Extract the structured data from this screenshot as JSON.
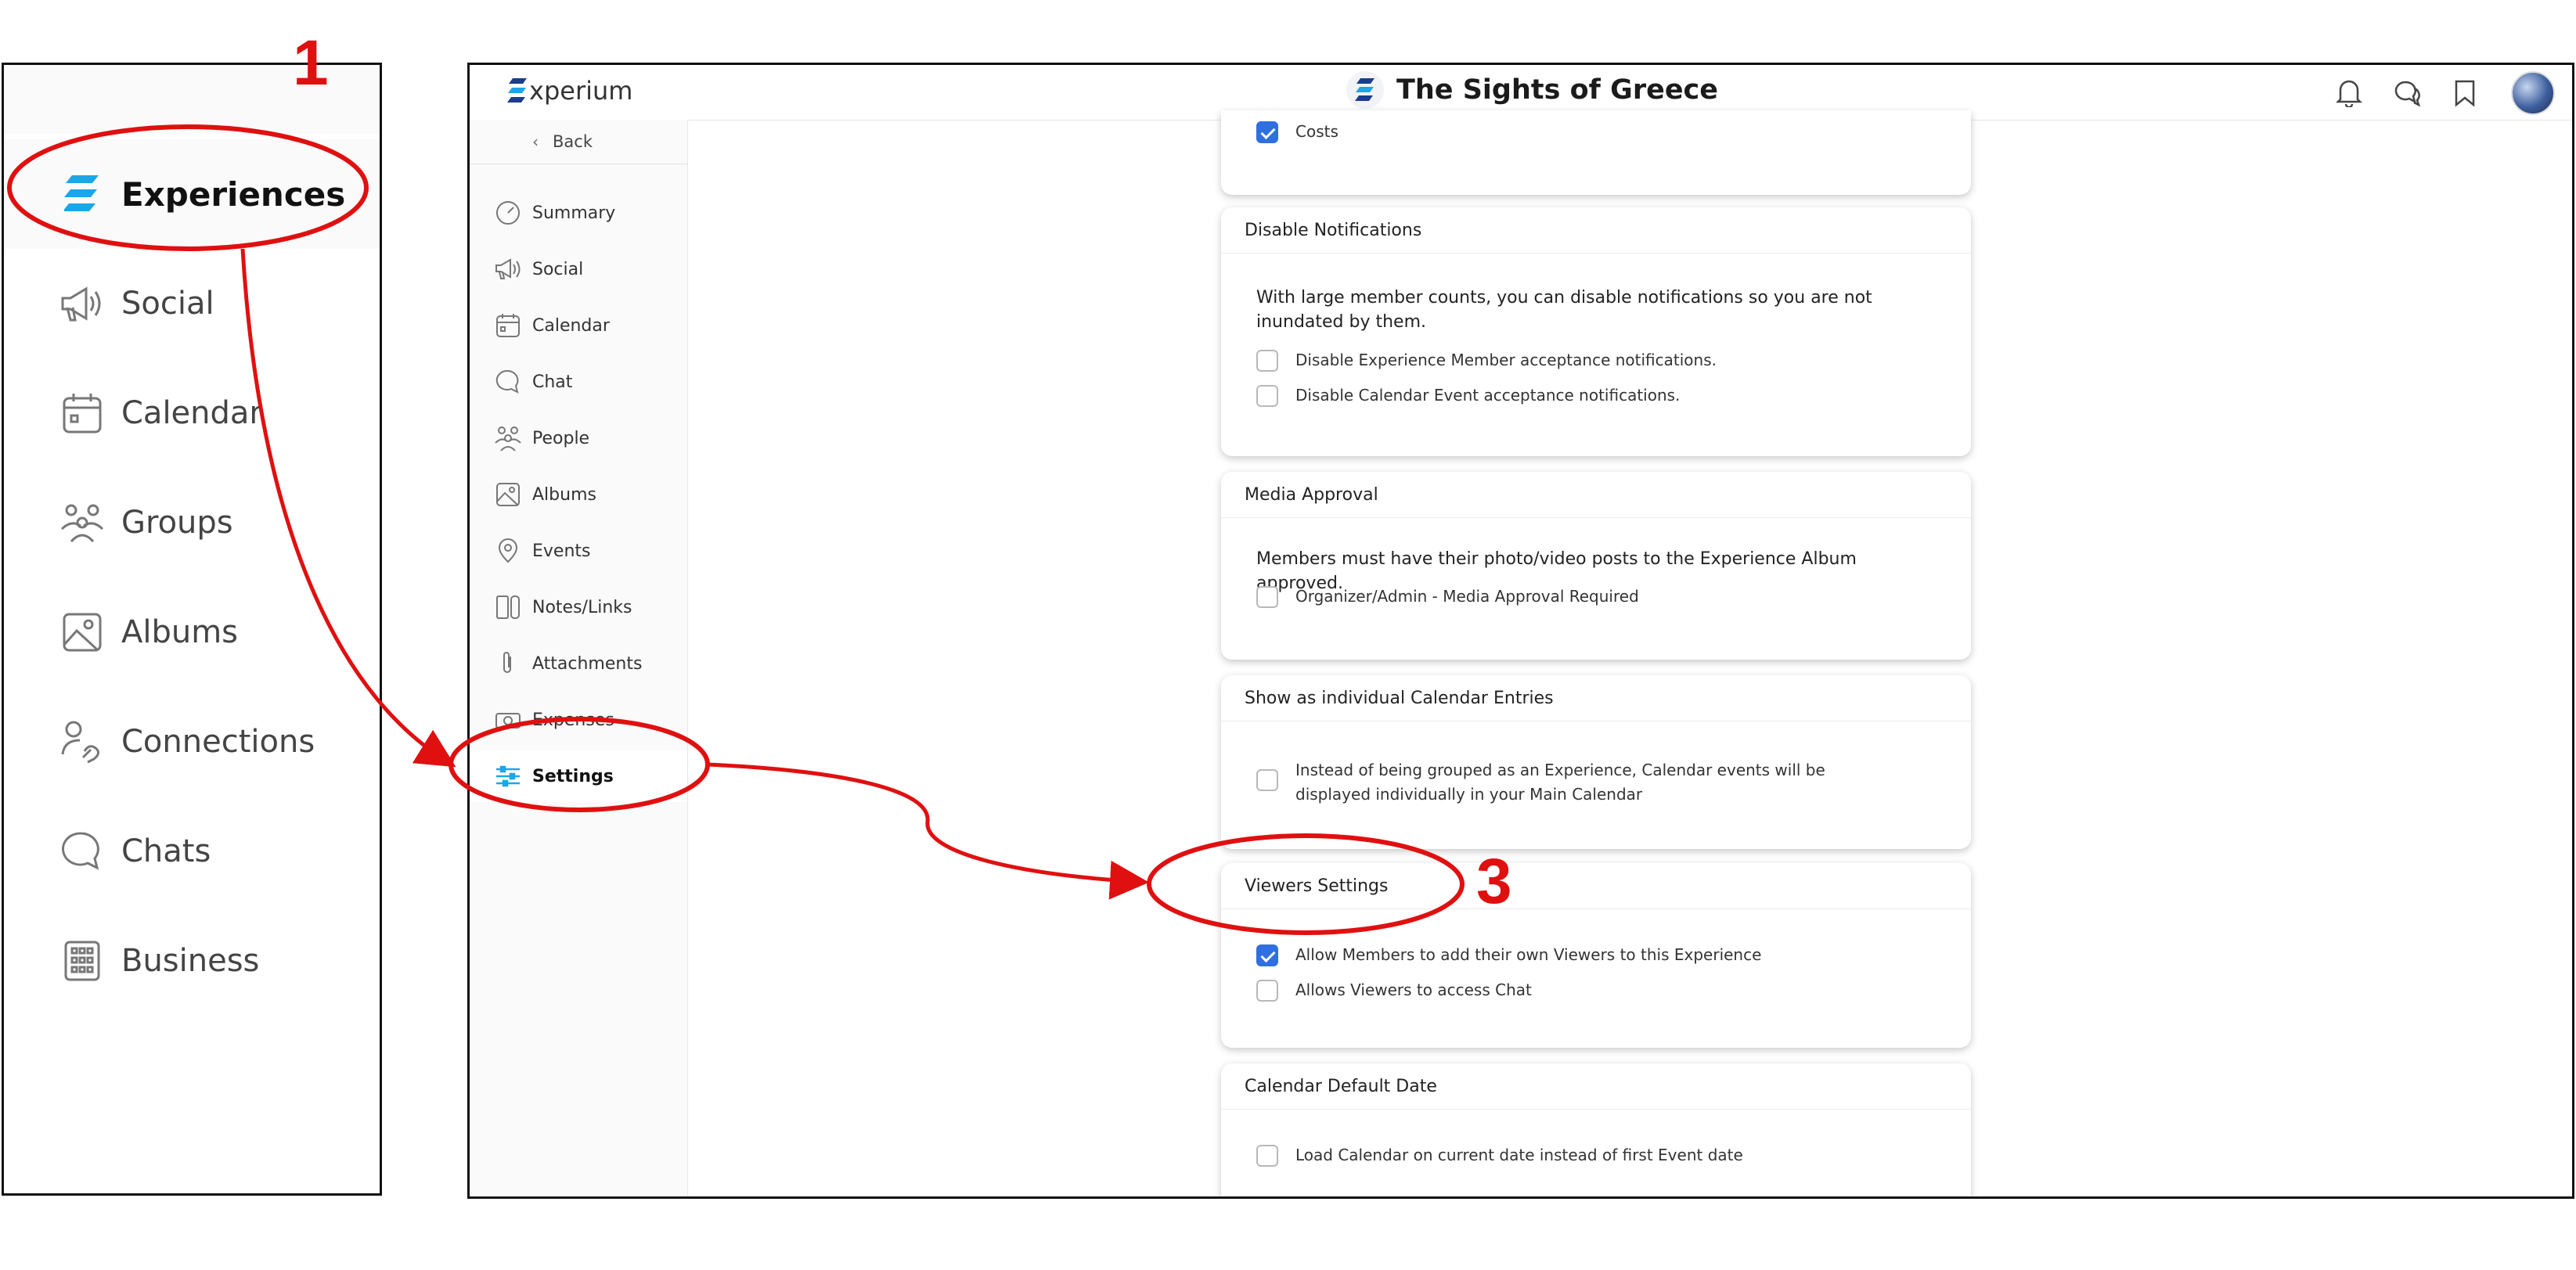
{
  "annotations": {
    "step1": "1",
    "step3": "3",
    "color": "#e01010"
  },
  "left_panel": {
    "items": [
      {
        "label": "Experiences",
        "icon": "experium-logo-icon",
        "active": true
      },
      {
        "label": "Social",
        "icon": "megaphone-icon"
      },
      {
        "label": "Calendar",
        "icon": "calendar-icon"
      },
      {
        "label": "Groups",
        "icon": "people-icon"
      },
      {
        "label": "Albums",
        "icon": "image-icon"
      },
      {
        "label": "Connections",
        "icon": "connections-icon"
      },
      {
        "label": "Chats",
        "icon": "chat-bubble-icon"
      },
      {
        "label": "Business",
        "icon": "building-icon"
      }
    ]
  },
  "topbar": {
    "brand": "xperium",
    "title": "The Sights of Greece",
    "icons": [
      "bell-icon",
      "chat-icon",
      "bookmark-icon",
      "user-avatar"
    ]
  },
  "sidebar": {
    "back": "Back",
    "items": [
      {
        "label": "Summary",
        "icon": "gauge-icon"
      },
      {
        "label": "Social",
        "icon": "megaphone-icon"
      },
      {
        "label": "Calendar",
        "icon": "calendar-icon"
      },
      {
        "label": "Chat",
        "icon": "chat-bubble-icon"
      },
      {
        "label": "People",
        "icon": "people-icon"
      },
      {
        "label": "Albums",
        "icon": "image-icon"
      },
      {
        "label": "Events",
        "icon": "location-pin-icon"
      },
      {
        "label": "Notes/Links",
        "icon": "notes-icon"
      },
      {
        "label": "Attachments",
        "icon": "paperclip-icon"
      },
      {
        "label": "Expenses",
        "icon": "money-icon"
      },
      {
        "label": "Settings",
        "icon": "sliders-icon",
        "active": true
      }
    ]
  },
  "cards": {
    "costs": {
      "option": "Costs",
      "checked": true
    },
    "notifications": {
      "title": "Disable Notifications",
      "description": "With large member counts, you can disable notifications so you are not inundated by them.",
      "options": [
        {
          "label": "Disable Experience Member acceptance notifications.",
          "checked": false
        },
        {
          "label": "Disable Calendar Event acceptance notifications.",
          "checked": false
        }
      ]
    },
    "media": {
      "title": "Media Approval",
      "description": "Members must have their photo/video posts to the Experience Album approved.",
      "options": [
        {
          "label": "Organizer/Admin - Media Approval Required",
          "checked": false
        }
      ]
    },
    "calendar_entries": {
      "title": "Show as individual Calendar Entries",
      "options": [
        {
          "label": "Instead of being grouped as an Experience, Calendar events will be displayed individually in your Main Calendar",
          "checked": false
        }
      ]
    },
    "viewers": {
      "title": "Viewers Settings",
      "options": [
        {
          "label": "Allow Members to add their own Viewers to this Experience",
          "checked": true
        },
        {
          "label": "Allows Viewers to access Chat",
          "checked": false
        }
      ]
    },
    "default_date": {
      "title": "Calendar Default Date",
      "options": [
        {
          "label": "Load Calendar on current date instead of first Event date",
          "checked": false
        }
      ]
    }
  }
}
